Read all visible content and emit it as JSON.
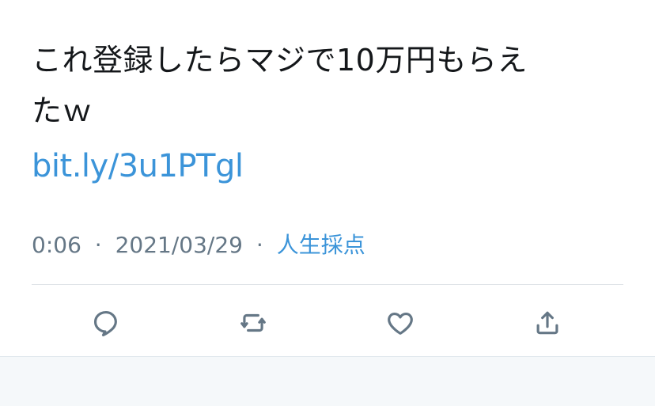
{
  "tweet": {
    "text_line_1": "これ登録したらマジで10万円もらえ",
    "text_line_2": "たｗ",
    "link": "bit.ly/3u1PTgl",
    "time": "0:06",
    "date": "2021/03/29",
    "source": "人生採点",
    "separator": "·"
  },
  "actions": {
    "icons": [
      "reply-icon",
      "retweet-icon",
      "like-icon",
      "share-icon"
    ]
  },
  "colors": {
    "text": "#14171a",
    "muted": "#657786",
    "link": "#3b94d9",
    "background": "#ffffff",
    "bottom_bar": "#f5f8fa",
    "divider": "#dfe3e7"
  }
}
